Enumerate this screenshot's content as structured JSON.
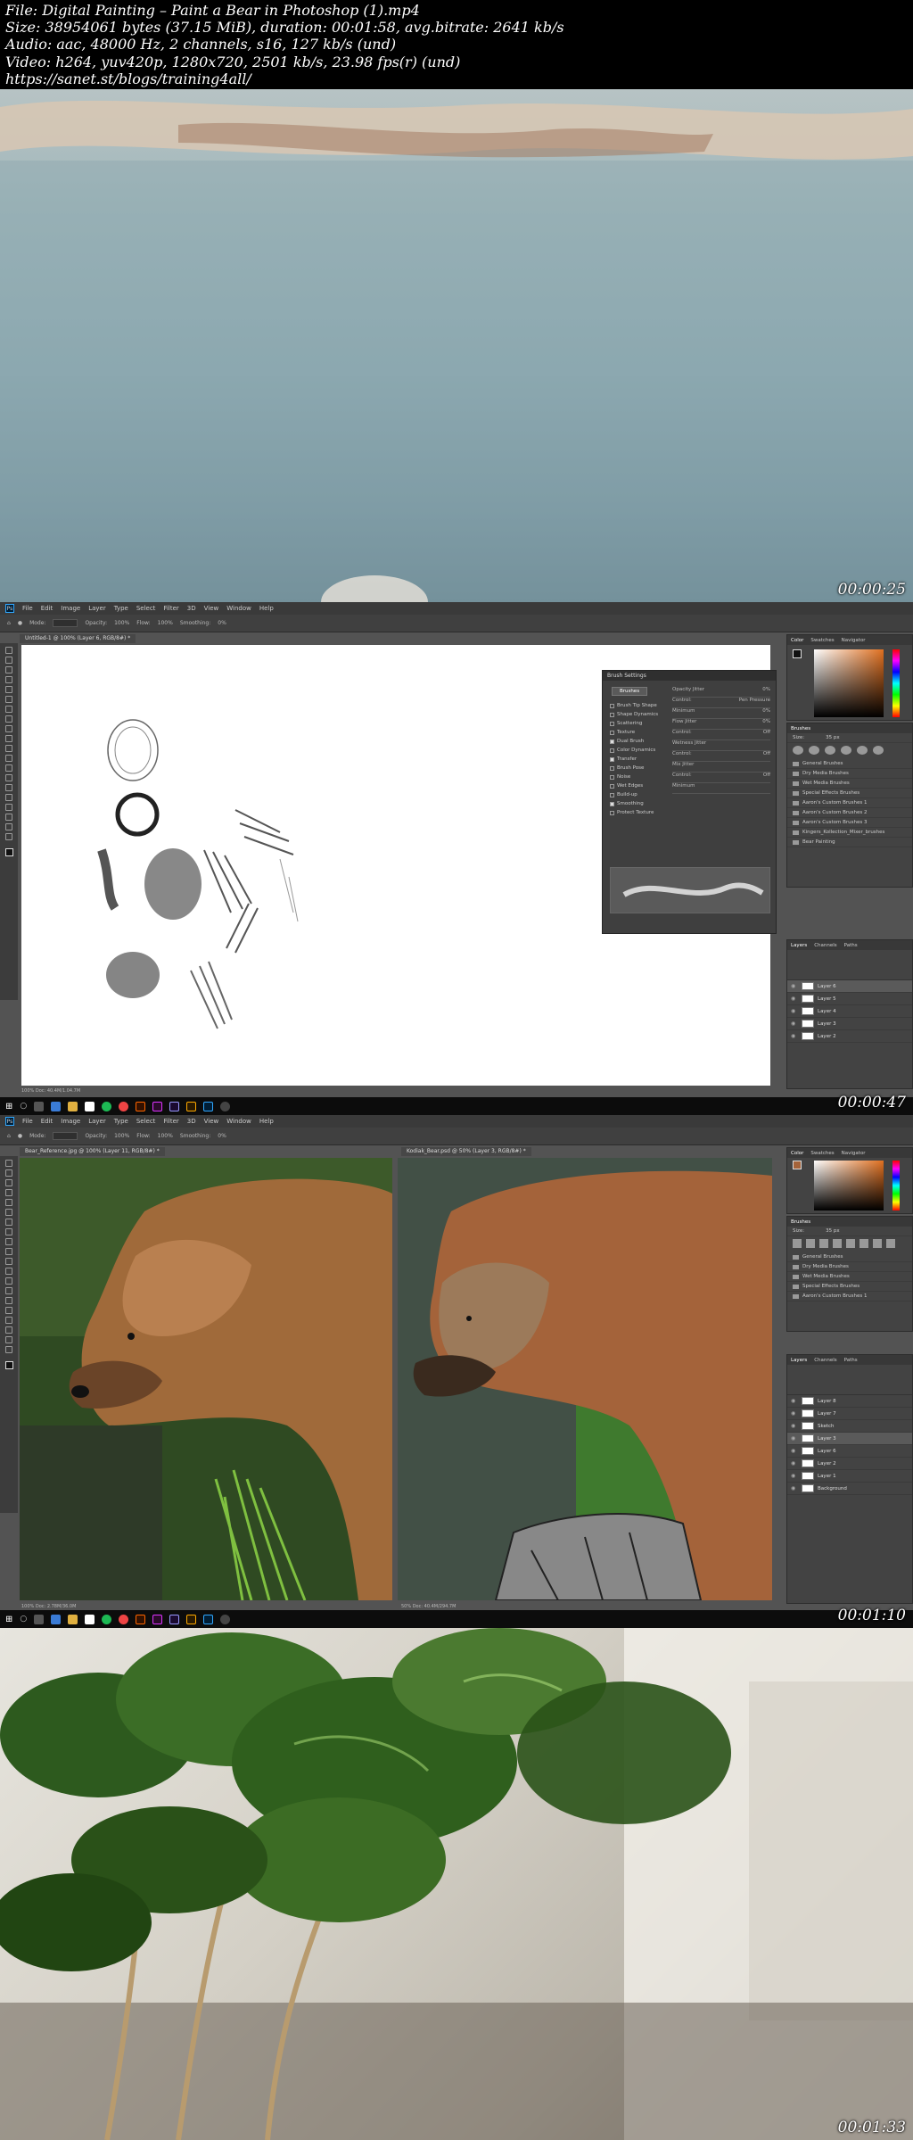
{
  "header": {
    "file": "File: Digital Painting – Paint a Bear in Photoshop (1).mp4",
    "size": "Size: 38954061 bytes (37.15 MiB), duration: 00:01:58, avg.bitrate: 2641 kb/s",
    "audio": "Audio: aac, 48000 Hz, 2 channels, s16, 127 kb/s (und)",
    "video": "Video: h264, yuv420p, 1280x720, 2501 kb/s, 23.98 fps(r) (und)",
    "url": "https://sanet.st/blogs/training4all/"
  },
  "timestamps": [
    "00:00:25",
    "00:00:47",
    "00:01:10",
    "00:01:33"
  ],
  "photoshop": {
    "logo": "Ps",
    "menu": [
      "File",
      "Edit",
      "Image",
      "Layer",
      "Type",
      "Select",
      "Filter",
      "3D",
      "View",
      "Window",
      "Help"
    ],
    "options": [
      "Mode:",
      "Normal",
      "Opacity:",
      "100%",
      "Flow:",
      "100%",
      "Smoothing:",
      "0%"
    ],
    "frame2": {
      "doc_tab": "Untitled-1 @ 100% (Layer 6, RGB/8#) *",
      "status": "100%    Doc: 40.4M/1.04.7M",
      "brush_settings": {
        "title": "Brush Settings",
        "button": "Brushes",
        "items": [
          "Brush Tip Shape",
          "Shape Dynamics",
          "Scattering",
          "Texture",
          "Dual Brush",
          "Color Dynamics",
          "Transfer",
          "Brush Pose",
          "Noise",
          "Wet Edges",
          "Build-up",
          "Smoothing",
          "Protect Texture"
        ],
        "checked": [
          false,
          false,
          false,
          false,
          true,
          false,
          true,
          false,
          false,
          false,
          false,
          true,
          false
        ],
        "right": [
          [
            "Opacity Jitter",
            "0%"
          ],
          [
            "Control:",
            "Pen Pressure"
          ],
          [
            "Minimum",
            "0%"
          ],
          [
            "Flow Jitter",
            "0%"
          ],
          [
            "Control:",
            "Off"
          ],
          [
            "Wetness Jitter",
            ""
          ],
          [
            "Control:",
            "Off"
          ],
          [
            "Mix Jitter",
            ""
          ],
          [
            "Control:",
            "Off"
          ],
          [
            "Minimum",
            ""
          ]
        ]
      },
      "color_tabs": [
        "Color",
        "Swatches",
        "Navigator"
      ],
      "brushes_title": "Brushes",
      "brush_size_label": "Size:",
      "brush_size": "35 px",
      "brush_folders": [
        "General Brushes",
        "Dry Media Brushes",
        "Wet Media Brushes",
        "Special Effects Brushes",
        "Aaron's Custom Brushes 1",
        "Aaron's Custom Brushes 2",
        "Aaron's Custom Brushes 3",
        "Kingers_Kollection_Mixer_brushes",
        "Bear Painting"
      ],
      "layers_tabs": [
        "Layers",
        "Channels",
        "Paths"
      ],
      "layers": [
        "Layer 6",
        "Layer 5",
        "Layer 4",
        "Layer 3",
        "Layer 2"
      ]
    },
    "frame3": {
      "doc_tab_left": "Bear_Reference.jpg @ 100% (Layer 11, RGB/8#) *",
      "doc_tab_right": "Kodiak_Bear.psd @ 50% (Layer 3, RGB/8#) *",
      "status_left": "100%    Doc: 2.78M/36.0M",
      "status_right": "50%    Doc: 40.4M/294.7M",
      "layers": [
        "Layer 8",
        "Layer 7",
        "Sketch",
        "Layer 3",
        "Layer 6",
        "Layer 2",
        "Layer 1",
        "Background"
      ],
      "brush_folders": [
        "General Brushes",
        "Dry Media Brushes",
        "Wet Media Brushes",
        "Special Effects Brushes",
        "Aaron's Custom Brushes 1"
      ]
    }
  },
  "colors": {
    "ps_bg": "#535353",
    "ps_panel": "#434343",
    "accent_blue": "#31a8ff"
  }
}
